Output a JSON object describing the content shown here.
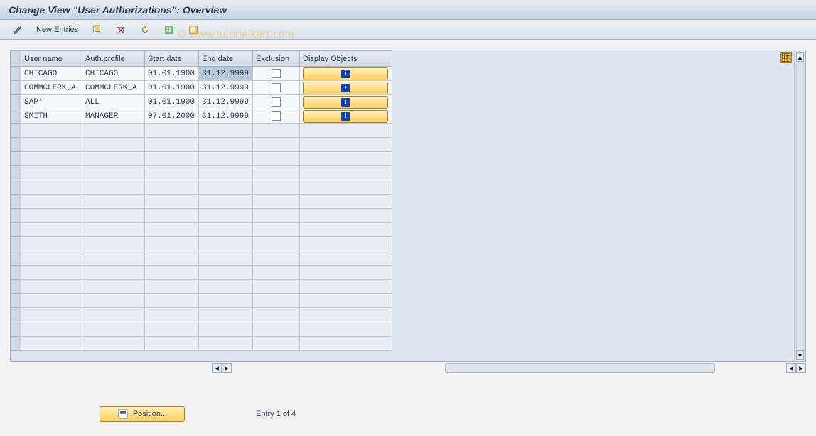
{
  "title": "Change View \"User Authorizations\": Overview",
  "watermark": "© www.tutorialkart.com",
  "toolbar": {
    "new_entries": "New Entries"
  },
  "columns": {
    "user": "User name",
    "profile": "Auth.profile",
    "start": "Start date",
    "end": "End date",
    "exclusion": "Exclusion",
    "display": "Display Objects"
  },
  "rows": [
    {
      "user": "CHICAGO",
      "profile": "CHICAGO",
      "start": "01.01.1900",
      "end": "31.12.9999",
      "excl": false
    },
    {
      "user": "COMMCLERK_A",
      "profile": "COMMCLERK_A",
      "start": "01.01.1900",
      "end": "31.12.9999",
      "excl": false
    },
    {
      "user": "SAP*",
      "profile": "ALL",
      "start": "01.01.1900",
      "end": "31.12.9999",
      "excl": false
    },
    {
      "user": "SMITH",
      "profile": "MANAGER",
      "start": "07.01.2000",
      "end": "31.12.9999",
      "excl": false
    }
  ],
  "empty_rows": 16,
  "selected_cell": {
    "row": 0,
    "col": "end"
  },
  "footer": {
    "position_label": "Position...",
    "entry_text": "Entry 1 of 4"
  }
}
